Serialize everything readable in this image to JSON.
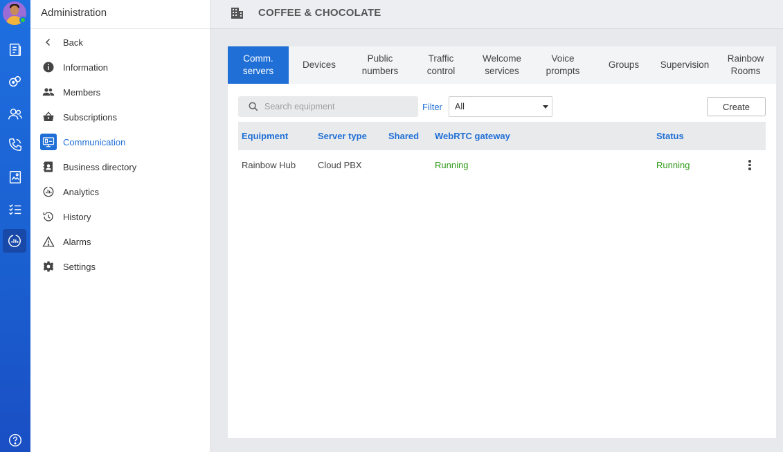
{
  "rail": {
    "items": [
      {
        "icon": "news-icon"
      },
      {
        "icon": "bubbles-icon"
      },
      {
        "icon": "contacts-icon"
      },
      {
        "icon": "phone-icon"
      },
      {
        "icon": "document-icon"
      },
      {
        "icon": "tasks-icon"
      },
      {
        "icon": "analytics-icon"
      },
      {
        "icon": "help-icon"
      }
    ]
  },
  "sidebar": {
    "title": "Administration",
    "items": [
      {
        "label": "Back",
        "icon": "chevron-left-icon"
      },
      {
        "label": "Information",
        "icon": "info-icon"
      },
      {
        "label": "Members",
        "icon": "members-icon"
      },
      {
        "label": "Subscriptions",
        "icon": "basket-icon"
      },
      {
        "label": "Communication",
        "icon": "communication-icon",
        "active": true
      },
      {
        "label": "Business directory",
        "icon": "directory-icon"
      },
      {
        "label": "Analytics",
        "icon": "analytics-icon"
      },
      {
        "label": "History",
        "icon": "history-icon"
      },
      {
        "label": "Alarms",
        "icon": "alarm-icon"
      },
      {
        "label": "Settings",
        "icon": "gear-icon"
      }
    ]
  },
  "header": {
    "org_name": "COFFEE & CHOCOLATE",
    "icon": "building-icon"
  },
  "tabs": [
    {
      "label": "Comm.\nservers",
      "active": true
    },
    {
      "label": "Devices"
    },
    {
      "label": "Public\nnumbers"
    },
    {
      "label": "Traffic\ncontrol"
    },
    {
      "label": "Welcome\nservices"
    },
    {
      "label": "Voice\nprompts"
    },
    {
      "label": "Groups"
    },
    {
      "label": "Supervision"
    },
    {
      "label": "Rainbow\nRooms"
    }
  ],
  "toolbar": {
    "search_placeholder": "Search equipment",
    "filter_label": "Filter",
    "filter_value": "All",
    "create_label": "Create"
  },
  "table": {
    "columns": [
      "Equipment",
      "Server type",
      "Shared",
      "WebRTC gateway",
      "Status"
    ],
    "rows": [
      {
        "equipment": "Rainbow Hub",
        "server_type": "Cloud PBX",
        "shared": "",
        "webrtc": "Running",
        "status": "Running"
      }
    ]
  },
  "colors": {
    "accent": "#1f6fd6",
    "running": "#2e9a17",
    "rail": "#1f6fe0"
  }
}
